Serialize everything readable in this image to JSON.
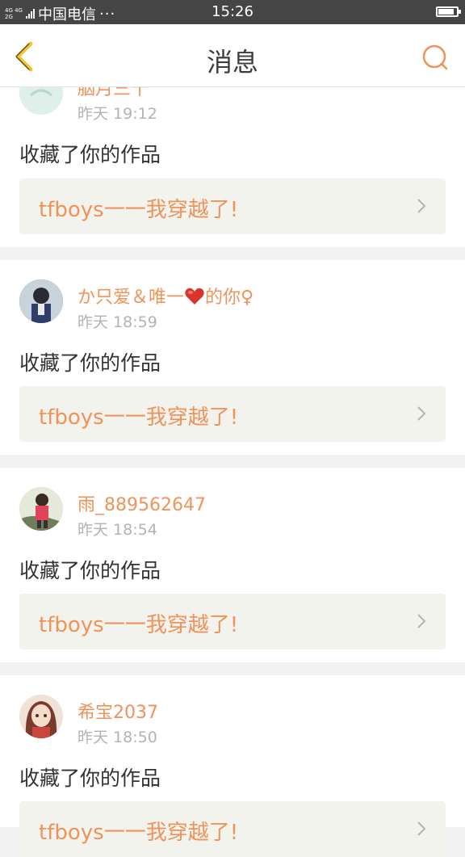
{
  "status_bar": {
    "network": "4G 4G 2G",
    "carrier": "中国电信",
    "more": "···",
    "time": "15:26",
    "battery_level": 0.85
  },
  "header": {
    "title": "消息",
    "back_icon": "chevron-left-icon",
    "search_icon": "search-icon"
  },
  "colors": {
    "accent": "#f0935a",
    "back_icon": "#f4c430",
    "card_bg": "#ffffff",
    "work_bg": "#f3f3ee"
  },
  "messages": [
    {
      "user": "胭月三十",
      "time": "昨天 19:12",
      "action": "收藏了你的作品",
      "work": "tfboys一一我穿越了!"
    },
    {
      "user_prefix": "か只爱＆唯一",
      "user_suffix": "的你♀",
      "time": "昨天 18:59",
      "action": "收藏了你的作品",
      "work": "tfboys一一我穿越了!"
    },
    {
      "user": "雨_889562647",
      "time": "昨天 18:54",
      "action": "收藏了你的作品",
      "work": "tfboys一一我穿越了!"
    },
    {
      "user": "希宝2037",
      "time": "昨天 18:50",
      "action": "收藏了你的作品",
      "work": "tfboys一一我穿越了!"
    }
  ]
}
